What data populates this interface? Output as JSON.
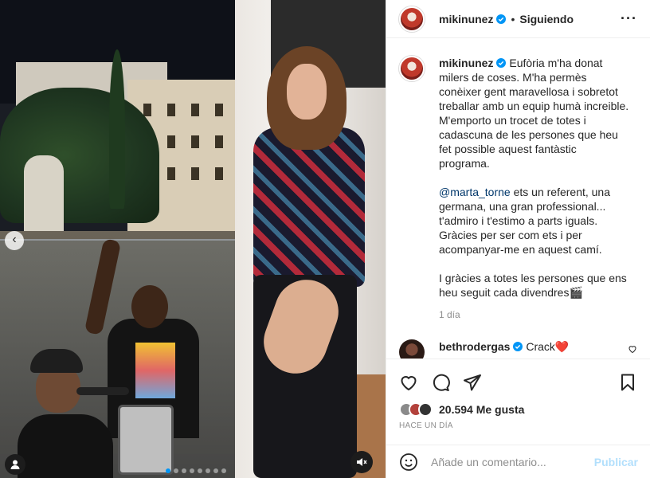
{
  "post": {
    "username": "mikinunez",
    "follow_status": "Siguiendo",
    "separator": "•",
    "more_icon": "more-horizontal-icon",
    "caption": {
      "username": "mikinunez",
      "p1": "Eufòria m'ha donat milers de coses. M'ha permès conèixer gent maravellosa i sobretot treballar amb un equip humà increible. M'emporto un trocet de totes i cadascuna de les persones que heu fet possible aquest fantàstic programa.",
      "mention": "@marta_torne",
      "p2_rest": " ets un referent, una germana, una gran professional... t'admiro i t'estimo a parts iguals. Gràcies per ser com ets i per acompanyar-me en aquest camí.",
      "p3": "I gràcies a totes les persones que ens heu seguit cada divendres",
      "p3_emoji": "🎬",
      "time": "1 día"
    },
    "comments": [
      {
        "username": "bethrodergas",
        "text": "Crack",
        "emoji": "❤️"
      }
    ],
    "likes": "20.594 Me gusta",
    "date": "HACE UN DÍA",
    "add_comment_placeholder": "Añade un comentario...",
    "publish_label": "Publicar"
  },
  "colors": {
    "verified": "#0095f6",
    "publish_disabled": "#b2dffc",
    "mention": "#00376b",
    "secondary_text": "#8e8e8e"
  },
  "media": {
    "carousel_slides": 8,
    "active_slide": 1
  }
}
